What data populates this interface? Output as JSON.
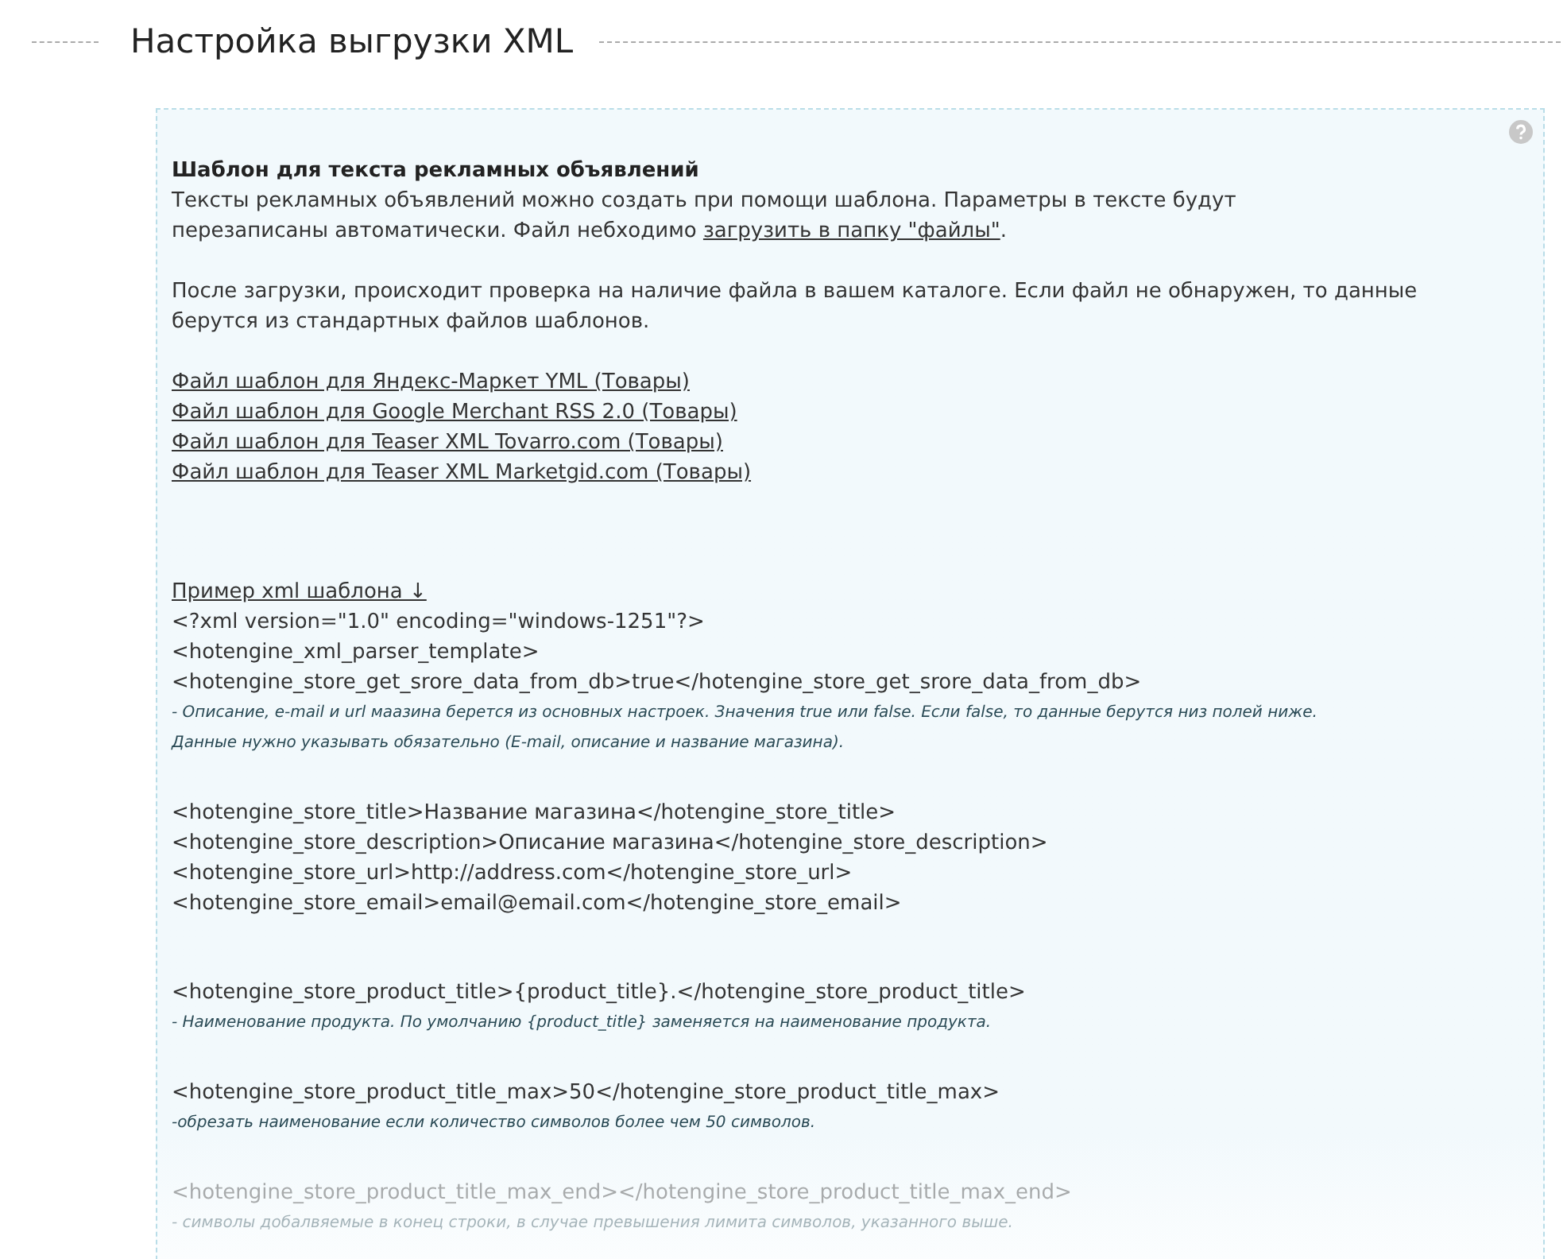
{
  "title": "Настройка выгрузки XML",
  "panel": {
    "heading": "Шаблон для текста рекламных объявлений",
    "intro": {
      "text": "Тексты рекламных объявлений можно создать при помощи шаблона. Параметры в тексте будут перезаписаны автоматически. Файл небходимо ",
      "link": "загрузить в папку \"файлы\"",
      "tail": "."
    },
    "paragraph": "После загрузки, происходит проверка на наличие файла в вашем каталоге. Если файл не обнаружен, то данные берутся из стандартных файлов шаблонов.",
    "file_links": [
      "Файл шаблон для Яндекс-Маркет YML (Товары)",
      "Файл шаблон для Google Merchant RSS 2.0 (Товары)",
      "Файл шаблон для Teaser XML Tovarro.com (Товары)",
      "Файл шаблон для Teaser XML Marketgid.com (Товары)"
    ],
    "example_link": "Пример xml шаблона ↓",
    "groups": [
      {
        "faded": false,
        "lines": [
          {
            "kind": "code",
            "text": "<?xml version=\"1.0\" encoding=\"windows-1251\"?>"
          },
          {
            "kind": "code",
            "text": "<hotengine_xml_parser_template>"
          },
          {
            "kind": "code",
            "text": "<hotengine_store_get_srore_data_from_db>true</hotengine_store_get_srore_data_from_db>"
          },
          {
            "kind": "note",
            "text": "- Описание, e-mail и url маазина берется из основных настроек. Значения true или false. Если false, то данные берутся низ полей ниже."
          },
          {
            "kind": "note",
            "text": "Данные нужно указывать обязательно (E-mail, описание и название магазина)."
          }
        ]
      },
      {
        "faded": false,
        "lines": [
          {
            "kind": "code",
            "text": "<hotengine_store_title>Название магазина</hotengine_store_title>"
          },
          {
            "kind": "code",
            "text": "<hotengine_store_description>Описание магазина</hotengine_store_description>"
          },
          {
            "kind": "code",
            "text": "<hotengine_store_url>http://address.com</hotengine_store_url>"
          },
          {
            "kind": "code",
            "text": "<hotengine_store_email>email@email.com</hotengine_store_email>"
          }
        ]
      },
      {
        "faded": false,
        "lines": [
          {
            "kind": "code",
            "text": "<hotengine_store_product_title>{product_title}.</hotengine_store_product_title>"
          },
          {
            "kind": "note",
            "text": "- Наименование продукта. По умолчанию {product_title} заменяется на наименование продукта."
          }
        ]
      },
      {
        "faded": false,
        "lines": [
          {
            "kind": "code",
            "text": "<hotengine_store_product_title_max>50</hotengine_store_product_title_max>"
          },
          {
            "kind": "note",
            "text": "-обрезать наименование если количество символов более чем 50 символов."
          }
        ]
      },
      {
        "faded": true,
        "lines": [
          {
            "kind": "code",
            "text": "<hotengine_store_product_title_max_end></hotengine_store_product_title_max_end>"
          },
          {
            "kind": "note",
            "text": "- символы добалвяемые в конец строки, в случае превышения лимита символов, указанного выше."
          }
        ]
      }
    ]
  }
}
